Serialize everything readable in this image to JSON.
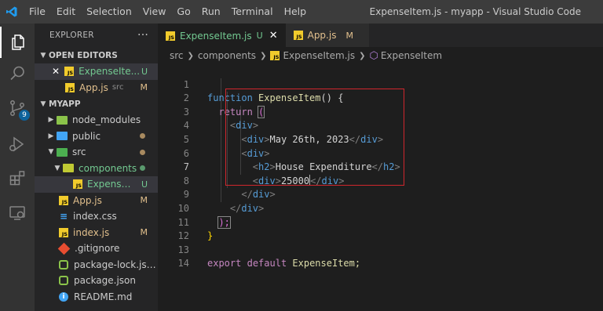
{
  "app": {
    "window_title": "ExpenseItem.js - myapp - Visual Studio Code",
    "menu": [
      "File",
      "Edit",
      "Selection",
      "View",
      "Go",
      "Run",
      "Terminal",
      "Help"
    ]
  },
  "activity_bar": {
    "items": [
      "explorer-icon",
      "search-icon",
      "source-control-icon",
      "run-debug-icon",
      "extensions-icon",
      "remote-explorer-icon"
    ],
    "source_control_badge": "9"
  },
  "sidebar": {
    "title": "EXPLORER",
    "more": "···",
    "open_editors": {
      "title": "OPEN EDITORS",
      "items": [
        {
          "name": "ExpenseIte...",
          "status": "U",
          "close": "✕"
        },
        {
          "name": "App.js",
          "desc": "src",
          "status": "M"
        }
      ]
    },
    "workspace": {
      "title": "MYAPP",
      "items": [
        {
          "name": "node_modules"
        },
        {
          "name": "public"
        },
        {
          "name": "src"
        },
        {
          "name": "components"
        },
        {
          "name": "ExpenseIt...",
          "status": "U"
        },
        {
          "name": "App.js",
          "status": "M"
        },
        {
          "name": "index.css"
        },
        {
          "name": "index.js",
          "status": "M"
        },
        {
          "name": ".gitignore"
        },
        {
          "name": "package-lock.json"
        },
        {
          "name": "package.json"
        },
        {
          "name": "README.md"
        }
      ]
    }
  },
  "tabs": [
    {
      "label": "ExpenseItem.js",
      "status": "U",
      "close": "✕",
      "active": true
    },
    {
      "label": "App.js",
      "status": "M",
      "active": false
    }
  ],
  "breadcrumb": {
    "parts": [
      "src",
      "components",
      "ExpenseItem.js",
      "ExpenseItem"
    ]
  },
  "editor": {
    "current_line": 7,
    "line_numbers": [
      "1",
      "2",
      "3",
      "4",
      "5",
      "6",
      "7",
      "8",
      "9",
      "10",
      "11",
      "12",
      "13",
      "14"
    ],
    "code": {
      "l1_kw": "function",
      "l1_fn": "ExpenseItem",
      "l1_rest": "() {",
      "l2_kw": "return",
      "l2_rest": "(",
      "l3_tag": "div",
      "l4_tag": "div",
      "l4_text": "May 26th, 2023",
      "l5_tag": "div",
      "l6_tag": "h2",
      "l6_text": "House Expenditure",
      "l7_tag": "div",
      "l7_text": "25000",
      "l8_tag": "div",
      "l9_tag": "div",
      "l10": ");",
      "l11": "}",
      "l13_kw1": "export",
      "l13_kw2": "default",
      "l13_name": "ExpenseItem;"
    }
  },
  "colors": {
    "accent": "#0e639c",
    "untracked": "#73c991",
    "modified": "#e2c08d",
    "highlight_box": "#d0262d"
  }
}
